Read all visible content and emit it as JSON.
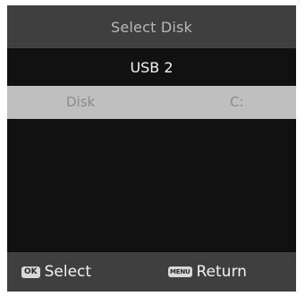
{
  "screen": {
    "title": "Select Disk",
    "device": "USB 2",
    "disk_row": {
      "label": "Disk",
      "value": "C:"
    },
    "footer": {
      "ok_key": "OK",
      "ok_label": "Select",
      "menu_key": "MENU",
      "menu_label": "Return"
    }
  },
  "colors": {
    "title_bar": "#3f3f3f",
    "background": "#111111",
    "highlight": "#bfbfbf"
  },
  "icons": [
    "ok-button-icon",
    "menu-button-icon"
  ]
}
